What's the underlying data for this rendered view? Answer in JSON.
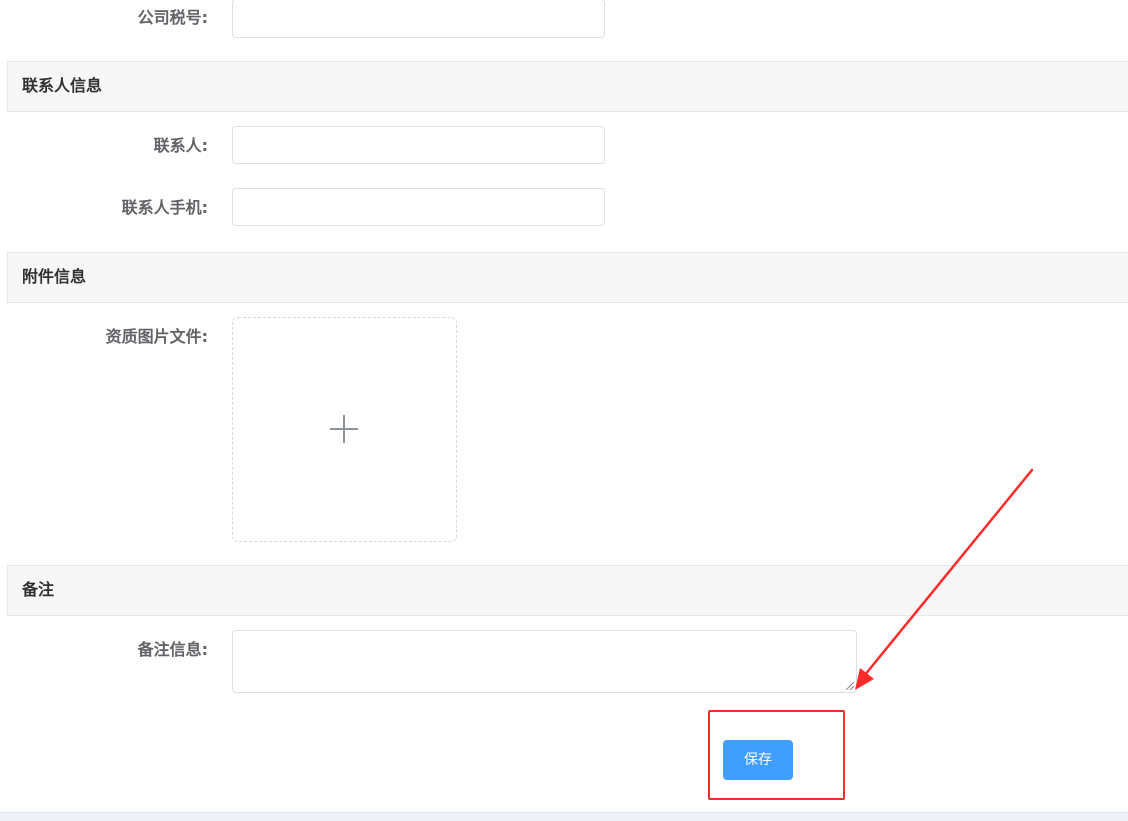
{
  "form": {
    "tax_id_label": "公司税号:",
    "contact_label": "联系人:",
    "contact_phone_label": "联系人手机:",
    "qualification_label": "资质图片文件:",
    "remark_label": "备注信息:"
  },
  "sections": {
    "contact_info": "联系人信息",
    "attachments": "附件信息",
    "remarks": "备注"
  },
  "actions": {
    "save_label": "保存"
  },
  "colors": {
    "primary": "#409eff",
    "annotation": "#ff2a2a"
  },
  "icons": {
    "upload": "plus-icon",
    "annotation": "arrow-icon"
  }
}
